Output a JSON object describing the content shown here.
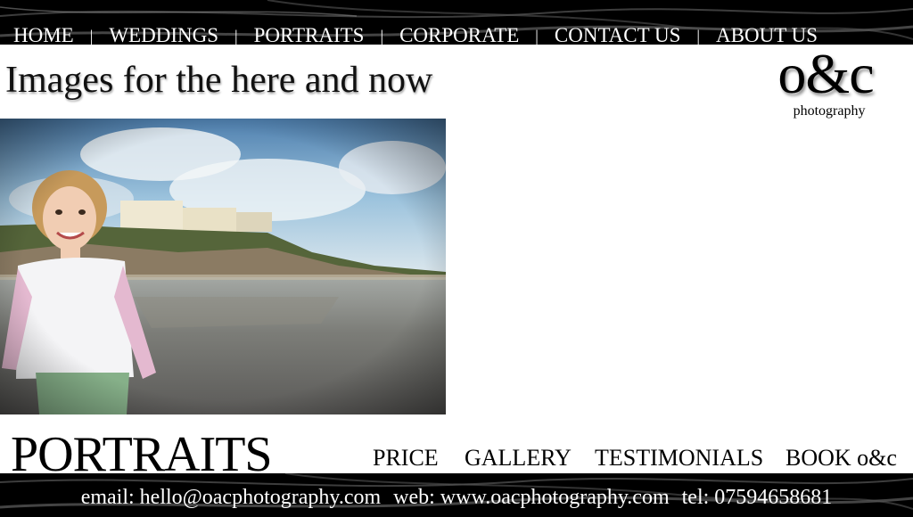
{
  "nav": {
    "items": [
      {
        "label": "HOME"
      },
      {
        "label": "WEDDINGS"
      },
      {
        "label": "PORTRAITS"
      },
      {
        "label": "CORPORATE"
      },
      {
        "label": "CONTACT US"
      },
      {
        "label": "ABOUT US"
      }
    ],
    "separator": "|"
  },
  "header": {
    "tagline": "Images for the here and now",
    "logo_mark": "o&c",
    "logo_sub": "photography"
  },
  "photo": {
    "subject": "girl-on-beach-photo"
  },
  "section": {
    "title": "PORTRAITS",
    "links": [
      {
        "label": "PRICE"
      },
      {
        "label": "GALLERY"
      },
      {
        "label": "TESTIMONIALS"
      },
      {
        "label": "BOOK o&c"
      }
    ]
  },
  "footer": {
    "email": "email: hello@oacphotography.com",
    "web": "web: www.oacphotography.com",
    "tel": "tel:  07594658681"
  },
  "colors": {
    "bars": "#000000",
    "background": "#ffffff",
    "text": "#000000"
  }
}
